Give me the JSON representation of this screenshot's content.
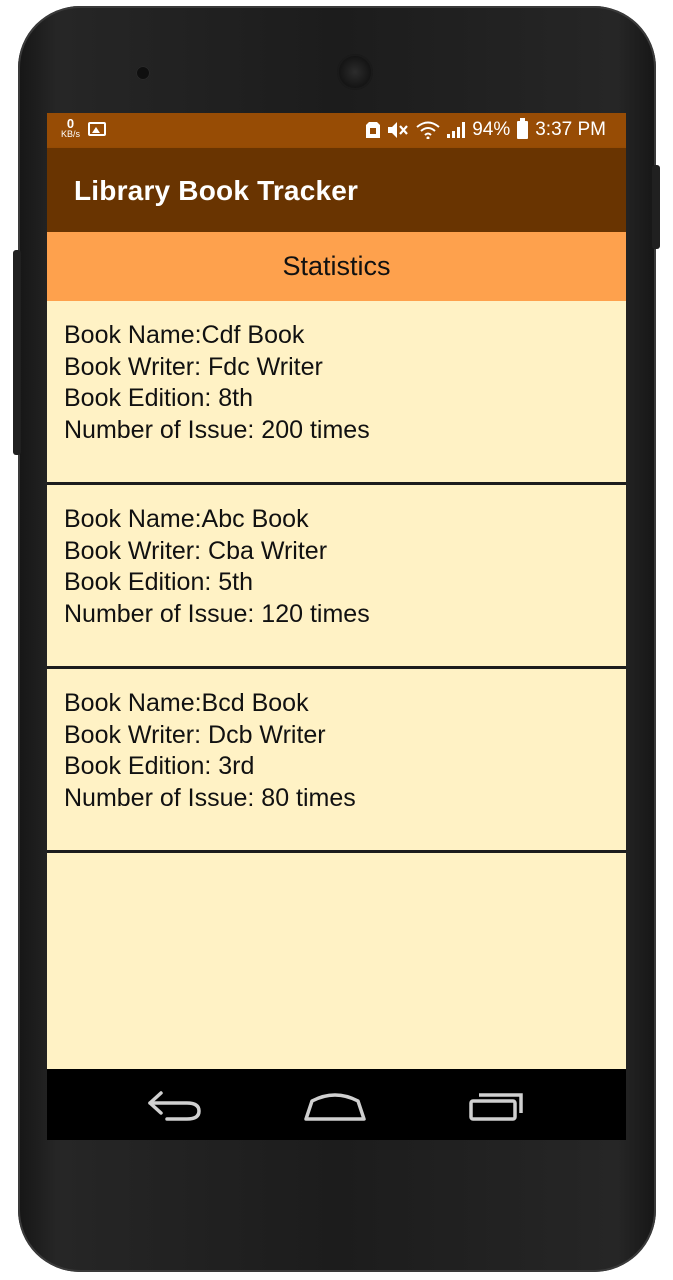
{
  "status_bar": {
    "speed_value": "0",
    "speed_unit": "KB/s",
    "battery_percent": "94%",
    "time": "3:37 PM"
  },
  "app_bar": {
    "title": "Library Book Tracker"
  },
  "section_header": {
    "label": "Statistics"
  },
  "books": [
    {
      "name": "Book Name:Cdf Book",
      "writer": "Book Writer: Fdc Writer",
      "edition": "Book Edition: 8th",
      "issues": "Number of Issue: 200 times"
    },
    {
      "name": "Book Name:Abc Book",
      "writer": "Book Writer: Cba Writer",
      "edition": "Book Edition: 5th",
      "issues": "Number of Issue: 120 times"
    },
    {
      "name": "Book Name:Bcd Book",
      "writer": "Book Writer: Dcb Writer",
      "edition": "Book Edition: 3rd",
      "issues": "Number of Issue: 80 times"
    }
  ],
  "colors": {
    "status_bar": "#974c05",
    "app_bar": "#693401",
    "section_header": "#fea14d",
    "list_background": "#fff2c5"
  },
  "icons": {
    "status_left": [
      "data-speed-icon",
      "image-notification-icon"
    ],
    "status_right": [
      "sim-icon",
      "mute-icon",
      "wifi-icon",
      "signal-icon",
      "battery-icon"
    ],
    "nav": [
      "back-icon",
      "home-icon",
      "recent-apps-icon"
    ]
  }
}
